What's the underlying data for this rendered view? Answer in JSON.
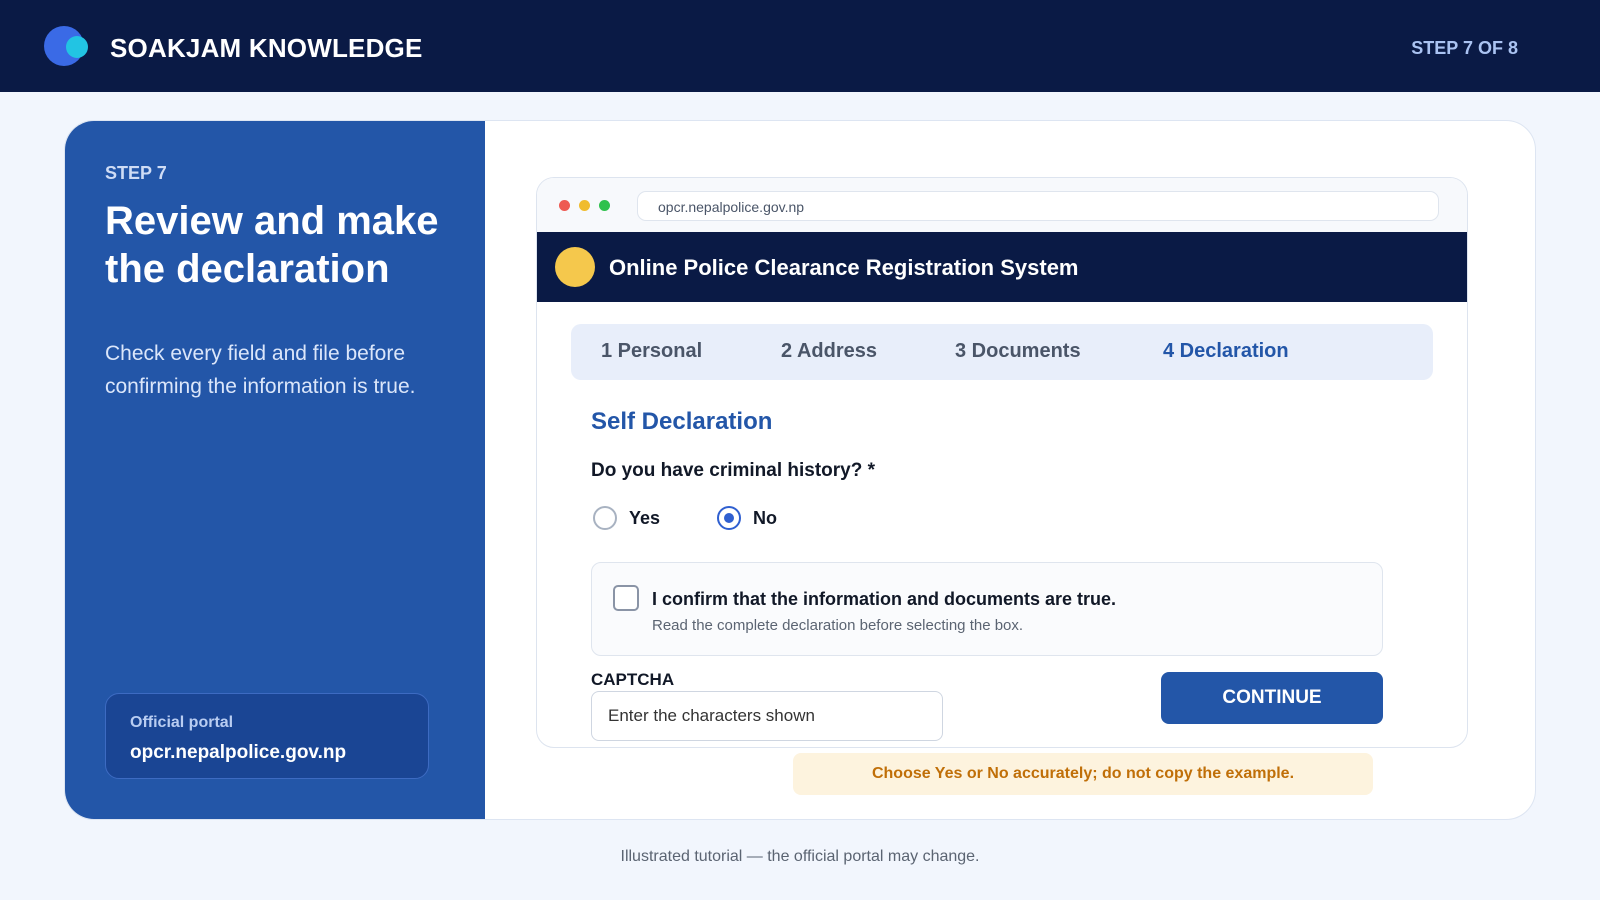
{
  "colors": {
    "navy": "#0a1a45",
    "primary_blue": "#2356a8",
    "background": "#f2f6fd",
    "emblem_yellow": "#f5c84c",
    "warning_bg": "#fdf3de",
    "warning_text": "#c06f08"
  },
  "header": {
    "brand": "SOAKJAM KNOWLEDGE",
    "logo_icon": "double-circle-logo",
    "step_indicator": "STEP 7 OF 8"
  },
  "left_panel": {
    "step_label": "STEP 7",
    "title": "Review and make the declaration",
    "description": "Check every field and file before confirming the information is true.",
    "portal_label": "Official portal",
    "portal_url": "opcr.nepalpolice.gov.np"
  },
  "browser": {
    "url": "opcr.nepalpolice.gov.np",
    "site_title": "Online Police Clearance Registration System",
    "tabs": [
      {
        "label": "1 Personal",
        "active": false
      },
      {
        "label": "2 Address",
        "active": false
      },
      {
        "label": "3 Documents",
        "active": false
      },
      {
        "label": "4 Declaration",
        "active": true
      }
    ],
    "section_title": "Self Declaration",
    "question": "Do you have criminal history? *",
    "options": [
      {
        "label": "Yes",
        "selected": false
      },
      {
        "label": "No",
        "selected": true
      }
    ],
    "confirm_text": "I confirm that the information and documents are true.",
    "confirm_subtext": "Read the complete declaration before selecting the box.",
    "confirm_checked": false,
    "captcha_label": "CAPTCHA",
    "captcha_placeholder": "Enter the characters shown",
    "captcha_value": "",
    "continue_label": "CONTINUE"
  },
  "warning": "Choose Yes or No accurately; do not copy the example.",
  "footer_note": "Illustrated tutorial — the official portal may change."
}
